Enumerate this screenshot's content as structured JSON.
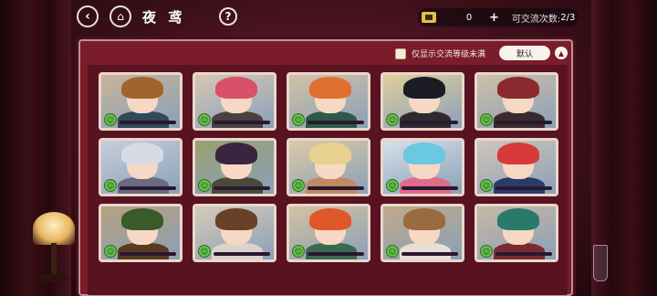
{
  "topbar": {
    "title": "夜 鸢",
    "help": "?",
    "currency_count": "0",
    "plus": "+",
    "chances_label": "可交流次数: ",
    "chances_value": "2/3"
  },
  "panel": {
    "filter_label": "仅显示交流等级未满",
    "sort_label": "默认",
    "sort_arrow": "▲"
  },
  "cards": [
    {
      "hair": "#a0652e",
      "body": "#2f4a5a",
      "bg": "#c9b49a",
      "status_icon": "smile-face-icon",
      "affinity": 0.0
    },
    {
      "hair": "#d8506a",
      "body": "#4a4040",
      "bg": "#d7c7b6",
      "status_icon": "smile-face-icon",
      "affinity": 0.0
    },
    {
      "hair": "#e07030",
      "body": "#2c5a48",
      "bg": "#d2c2a6",
      "status_icon": "smile-face-icon",
      "affinity": 0.0
    },
    {
      "hair": "#1c1c24",
      "body": "#2e2a30",
      "bg": "#e0cf9c",
      "status_icon": "smile-face-icon",
      "affinity": 0.0
    },
    {
      "hair": "#8a2a2e",
      "body": "#3a2a2c",
      "bg": "#cfbfa8",
      "status_icon": "smile-face-icon",
      "affinity": 0.0
    },
    {
      "hair": "#d6dbe6",
      "body": "#6a6a80",
      "bg": "#c8cedc",
      "status_icon": "smile-face-icon",
      "affinity": 0.0
    },
    {
      "hair": "#3a2440",
      "body": "#4a4a3a",
      "bg": "#9aa070",
      "status_icon": "smile-face-icon",
      "affinity": 0.0
    },
    {
      "hair": "#e8d090",
      "body": "#c08a60",
      "bg": "#dccaa6",
      "status_icon": "smile-face-icon",
      "affinity": 0.0
    },
    {
      "hair": "#6ac8e0",
      "body": "#e06a8a",
      "bg": "#d6e0e8",
      "status_icon": "smile-face-icon",
      "affinity": 0.0
    },
    {
      "hair": "#d83a3a",
      "body": "#2a3a6a",
      "bg": "#d0c6ba",
      "status_icon": "smile-face-icon",
      "affinity": 0.0
    },
    {
      "hair": "#3a5a2a",
      "body": "#5a3a20",
      "bg": "#b8a080",
      "status_icon": "smile-face-icon",
      "affinity": 0.0
    },
    {
      "hair": "#6a4028",
      "body": "#dcd4cc",
      "bg": "#d6cab8",
      "status_icon": "smile-face-icon",
      "affinity": 0.0
    },
    {
      "hair": "#e0582a",
      "body": "#3a6a50",
      "bg": "#d4c2a0",
      "status_icon": "smile-face-icon",
      "affinity": 0.0
    },
    {
      "hair": "#9a6a40",
      "body": "#e8e0d4",
      "bg": "#c0aa8a",
      "status_icon": "smile-face-icon",
      "affinity": 0.0
    },
    {
      "hair": "#2a7a6a",
      "body": "#7a2a30",
      "bg": "#c8b8a4",
      "status_icon": "smile-face-icon",
      "affinity": 0.0
    }
  ]
}
